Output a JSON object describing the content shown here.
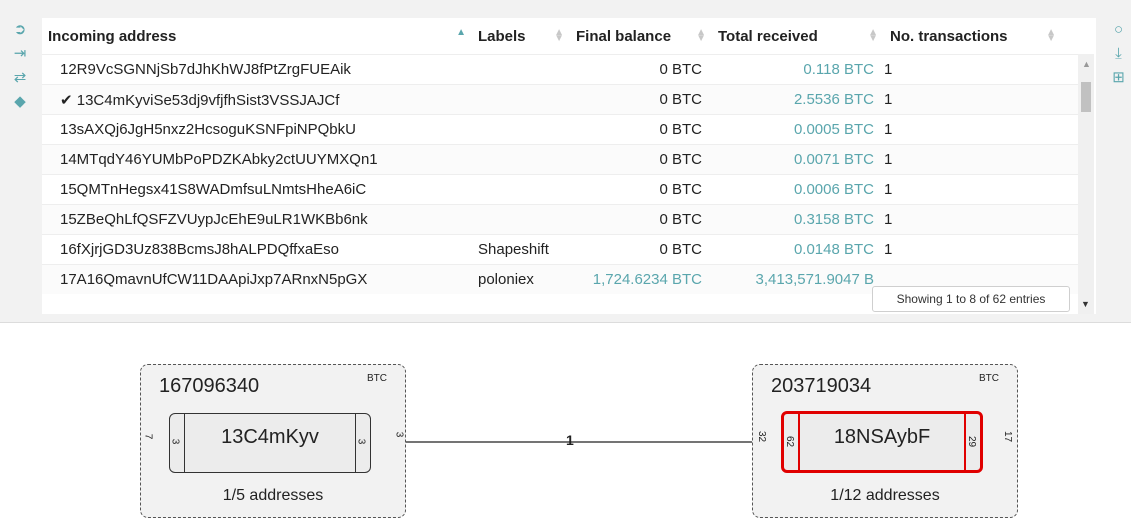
{
  "sidebar_left": {
    "icons": [
      "sign-in-icon",
      "sign-out-icon",
      "exchange-icon",
      "tags-icon"
    ]
  },
  "sidebar_right": {
    "icons": [
      "search-icon",
      "download-icon",
      "plus-square-icon"
    ]
  },
  "table": {
    "headers": [
      "Incoming address",
      "Labels",
      "Final balance",
      "Total received",
      "No. transactions"
    ],
    "rows": [
      {
        "address": "12R9VcSGNNjSb7dJhKhWJ8fPtZrgFUEAik",
        "label": "",
        "final": "0 BTC",
        "received": "0.118 BTC",
        "tx": "1",
        "check": ""
      },
      {
        "address": "13C4mKyviSe53dj9vfjfhSist3VSSJAJCf",
        "label": "",
        "final": "0 BTC",
        "received": "2.5536 BTC",
        "tx": "1",
        "check": "✔ "
      },
      {
        "address": "13sAXQj6JgH5nxz2HcsoguKSNFpiNPQbkU",
        "label": "",
        "final": "0 BTC",
        "received": "0.0005 BTC",
        "tx": "1",
        "check": ""
      },
      {
        "address": "14MTqdY46YUMbPoPDZKAbky2ctUUYMXQn1",
        "label": "",
        "final": "0 BTC",
        "received": "0.0071 BTC",
        "tx": "1",
        "check": ""
      },
      {
        "address": "15QMTnHegsx41S8WADmfsuLNmtsHheA6iC",
        "label": "",
        "final": "0 BTC",
        "received": "0.0006 BTC",
        "tx": "1",
        "check": ""
      },
      {
        "address": "15ZBeQhLfQSFZVUypJcEhE9uLR1WKBb6nk",
        "label": "",
        "final": "0 BTC",
        "received": "0.3158 BTC",
        "tx": "1",
        "check": ""
      },
      {
        "address": "16fXjrjGD3Uz838BcmsJ8hALPDQffxaEso",
        "label": "Shapeshift",
        "final": "0 BTC",
        "received": "0.0148 BTC",
        "tx": "1",
        "check": ""
      },
      {
        "address": "17A16QmavnUfCW11DAApiJxp7ARnxN5pGX",
        "label": "poloniex",
        "final": "1,724.6234 BTC",
        "received": "3,413,571.9047 B",
        "tx": "",
        "check": ""
      }
    ],
    "info": "Showing 1 to 8 of 62 entries"
  },
  "graph": {
    "left_cluster": {
      "id": "167096340",
      "currency": "BTC",
      "side_left": "7",
      "footer": "1/5 addresses",
      "address": {
        "label": "13C4mKyv",
        "in": "3",
        "out": "3",
        "edge_out": "3"
      }
    },
    "right_cluster": {
      "id": "203719034",
      "currency": "BTC",
      "side_right": "17",
      "footer": "1/12 addresses",
      "address": {
        "label": "18NSAybF",
        "in": "62",
        "out": "29",
        "edge_in": "32"
      }
    },
    "edge_label": "1"
  },
  "colors": {
    "accent": "#5aa6ad",
    "selected": "#e00000"
  }
}
